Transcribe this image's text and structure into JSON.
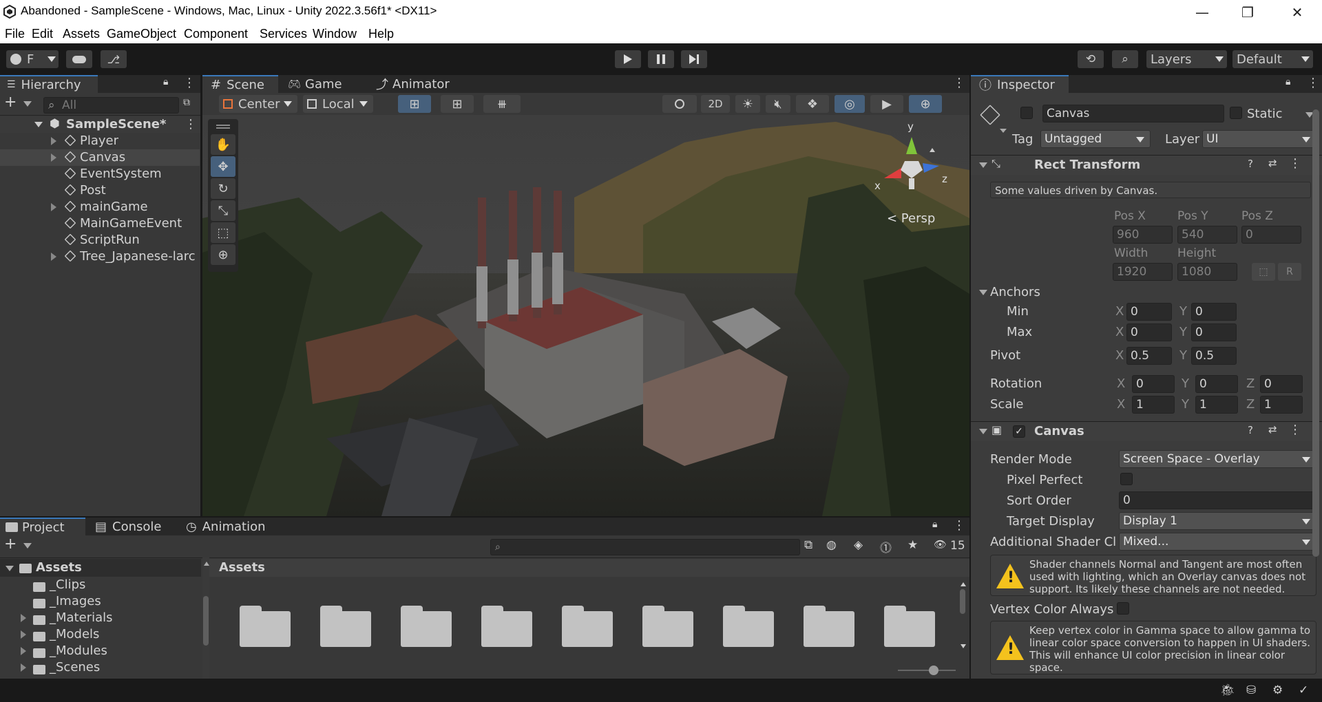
{
  "window": {
    "title": "Abandoned - SampleScene - Windows, Mac, Linux - Unity 2022.3.56f1* <DX11>",
    "min": "—",
    "max": "❐",
    "close": "✕"
  },
  "menu": [
    "File",
    "Edit",
    "Assets",
    "GameObject",
    "Component",
    "Services",
    "Window",
    "Help"
  ],
  "toolbar": {
    "account": "F",
    "layers": "Layers",
    "layout": "Default"
  },
  "hierarchy": {
    "tab": "Hierarchy",
    "search_placeholder": "All",
    "scene": "SampleScene*",
    "items": [
      "Player",
      "Canvas",
      "EventSystem",
      "Post",
      "mainGame",
      "MainGameEvent",
      "ScriptRun",
      "Tree_Japanese-larc"
    ],
    "expandable": [
      true,
      true,
      false,
      false,
      true,
      false,
      false,
      true
    ],
    "selected": 1
  },
  "scene_tabs": [
    "Scene",
    "Game",
    "Animator"
  ],
  "scene_toolbar": {
    "pivot": "Center",
    "space": "Local",
    "mode2d": "2D"
  },
  "scene_view": {
    "persp": "< Persp",
    "axis_x": "x",
    "axis_y": "y",
    "axis_z": "z"
  },
  "inspector": {
    "tab": "Inspector",
    "name": "Canvas",
    "static": "Static",
    "tag_label": "Tag",
    "tag": "Untagged",
    "layer_label": "Layer",
    "layer": "UI",
    "rect": {
      "title": "Rect Transform",
      "note": "Some values driven by Canvas.",
      "hdr": [
        "Pos X",
        "Pos Y",
        "Pos Z"
      ],
      "pos": [
        "960",
        "540",
        "0"
      ],
      "size_hdr": [
        "Width",
        "Height"
      ],
      "size": [
        "1920",
        "1080"
      ],
      "r_btn": "R",
      "anchors": "Anchors",
      "min": "Min",
      "max": "Max",
      "min_vals": [
        "0",
        "0"
      ],
      "max_vals": [
        "0",
        "0"
      ],
      "pivot": "Pivot",
      "pivot_vals": [
        "0.5",
        "0.5"
      ],
      "rotation": "Rotation",
      "rot_vals": [
        "0",
        "0",
        "0"
      ],
      "scale": "Scale",
      "scale_vals": [
        "1",
        "1",
        "1"
      ],
      "x": "X",
      "y": "Y",
      "z": "Z"
    },
    "canvas": {
      "title": "Canvas",
      "render_mode_label": "Render Mode",
      "render_mode": "Screen Space - Overlay",
      "pixel_perfect": "Pixel Perfect",
      "sort_order_label": "Sort Order",
      "sort_order": "0",
      "target_display_label": "Target Display",
      "target_display": "Display 1",
      "shader_label": "Additional Shader Cl",
      "shader": "Mixed...",
      "warn1": "Shader channels Normal and Tangent are most often used with lighting, which an Overlay canvas does not support. Its likely these channels are not needed.",
      "vertex_label": "Vertex Color Always",
      "warn2": "Keep vertex color in Gamma space to allow gamma to linear color space conversion to happen in UI shaders. This will enhance UI color precision in linear color space."
    }
  },
  "bottom_tabs": [
    "Project",
    "Console",
    "Animation"
  ],
  "project": {
    "tree_root": "Assets",
    "tree": [
      "_Clips",
      "_Images",
      "_Materials",
      "_Models",
      "_Modules",
      "_Scenes"
    ],
    "tree_expand": [
      false,
      false,
      true,
      true,
      true,
      true
    ],
    "breadcrumb": "Assets",
    "count": "15",
    "folder_count": 9
  }
}
